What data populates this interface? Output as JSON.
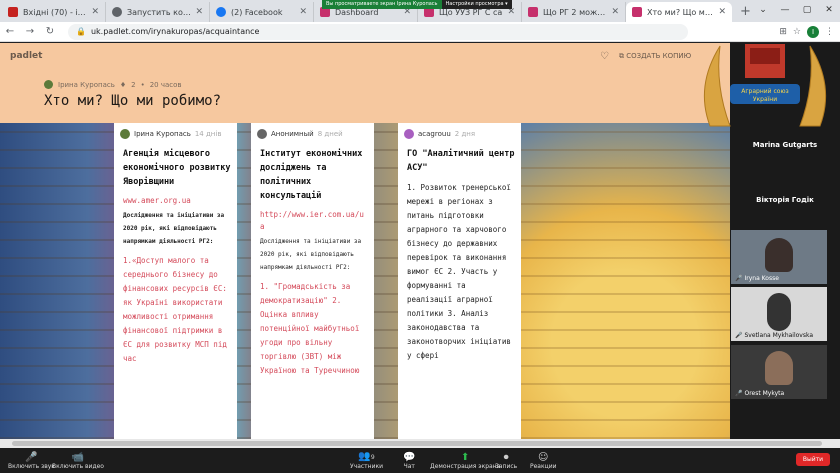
{
  "browser": {
    "tabs": [
      {
        "title": "Вхідні (70) - iryna.k",
        "color": "#c5221f"
      },
      {
        "title": "Запустить конфер",
        "color": "#5f6368"
      },
      {
        "title": "(2) Facebook",
        "color": "#1877f2"
      },
      {
        "title": "Dashboard",
        "color": "#c6306c"
      },
      {
        "title": "Що УУЗ РГ С са",
        "color": "#c6306c"
      },
      {
        "title": "Що РГ 2 може да",
        "color": "#c6306c"
      },
      {
        "title": "Хто ми? Що ми ро",
        "color": "#c6306c"
      }
    ],
    "new_tab": "+",
    "url": "uk.padlet.com/irynakuropas/acquaintance",
    "profile_initial": "I",
    "zoom_banner": "Вы просматриваете экран Ірина Куропась",
    "zoom_banner_btn": "Настройки просмотра ▾"
  },
  "padlet": {
    "logo": "padlet",
    "make_copy": "СОЗДАТЬ КОПИЮ",
    "author": "Ірина Куропась",
    "likes": "2",
    "time": "20 часов",
    "title": "Хто ми? Що ми робимо?",
    "cards": [
      {
        "author": "Ірина Куропась",
        "time": "14 днів",
        "title": "Агенція місцевого економічного розвитку Яворівщини",
        "link": "www.amer.org.ua",
        "small": "Дослідження та ініціативи за 2020 рік, які відповідають напрямкам діяльності РГ2:",
        "body": "1.«Доступ малого та середнього бізнесу до фінансових ресурсів ЄС: як Україні використати можливості отримання фінансової підтримки в ЄС для розвитку МСП під час"
      },
      {
        "author": "Анонимный",
        "time": "8 дней",
        "title": "Інститут економічних досліджень та політичних консультацій",
        "link": "http://www.ier.com.ua/ua",
        "small": "Дослідження та ініціативи за 2020 рік, які відповідають напрямкам діяльності РГ2:",
        "body": "1. \"Громадськість за демократизацію\" 2. Оцінка впливу потенційної майбутньої угоди про вільну торгівлю (ЗВТ) між Україною та Туреччиною"
      },
      {
        "author": "acagrouu",
        "time": "2 дня",
        "title": "ГО \"Аналітичний центр АСУ\"",
        "body": "1. Розвиток тренерської мережі в регіонах з питань підготовки аграрного та харчового бізнесу до державних перевірок та виконання вимог ЄС 2. Участь у формуванні та реалізації аграрної політики 3. Аналіз законодавства та законотворчих ініціатив у сфері"
      }
    ]
  },
  "participants": {
    "emblem_text": "Аграрний союз України",
    "names": [
      "Marina Gutgarts",
      "Вікторія Годік",
      "Iryna Kosse",
      "Svetlana Mykhailovska",
      "Orest Mykyta"
    ]
  },
  "meeting": {
    "buttons": [
      {
        "label": "Включить звук",
        "icon": "🎤"
      },
      {
        "label": "Включить видео",
        "icon": "📹"
      },
      {
        "label": "Участники",
        "icon": "👥",
        "count": "9"
      },
      {
        "label": "Чат",
        "icon": "💬"
      },
      {
        "label": "Демонстрация экрана",
        "icon": "⬆"
      },
      {
        "label": "Запись",
        "icon": "⏺"
      },
      {
        "label": "Реакции",
        "icon": "☺"
      }
    ],
    "leave": "Выйти"
  }
}
